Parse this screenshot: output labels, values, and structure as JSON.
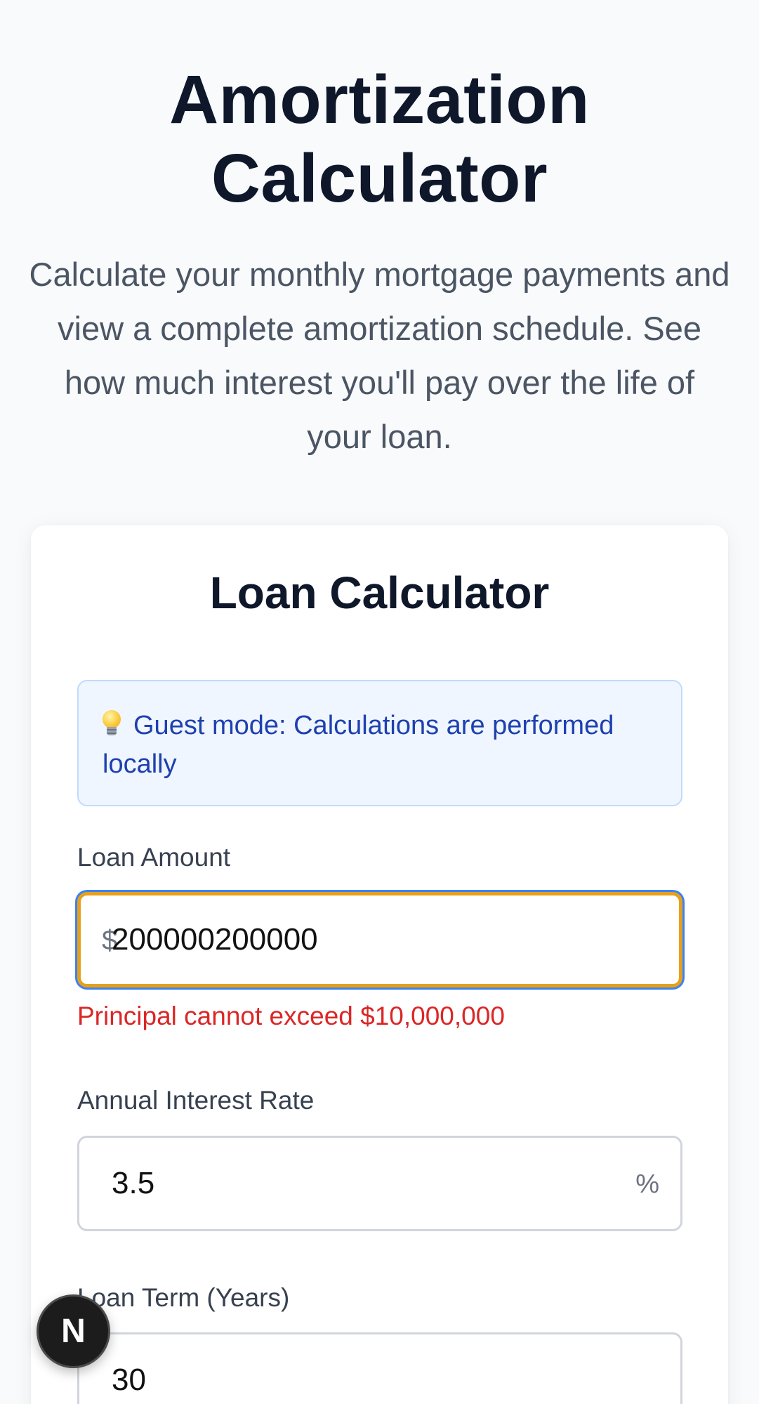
{
  "header": {
    "title": "Amortization Calculator",
    "subtitle": "Calculate your monthly mortgage payments and view a complete amortization schedule. See how much interest you'll pay over the life of your loan."
  },
  "calculator": {
    "title": "Loan Calculator",
    "notice": {
      "icon": "lightbulb-icon",
      "text": "Guest mode: Calculations are performed locally"
    },
    "loan_amount": {
      "label": "Loan Amount",
      "prefix": "$",
      "value": "200000200000",
      "error": "Principal cannot exceed $10,000,000"
    },
    "interest_rate": {
      "label": "Annual Interest Rate",
      "value": "3.5",
      "suffix": "%"
    },
    "loan_term": {
      "label": "Loan Term (Years)",
      "value": "30"
    }
  },
  "floating_button": {
    "label": "N"
  },
  "colors": {
    "background": "#f8fafc",
    "title": "#0f172a",
    "notice_bg": "#eff6ff",
    "notice_text": "#1e40af",
    "error": "#dc2626",
    "focus_ring": "#e5a11c",
    "focus_outline": "#3b82f6"
  }
}
